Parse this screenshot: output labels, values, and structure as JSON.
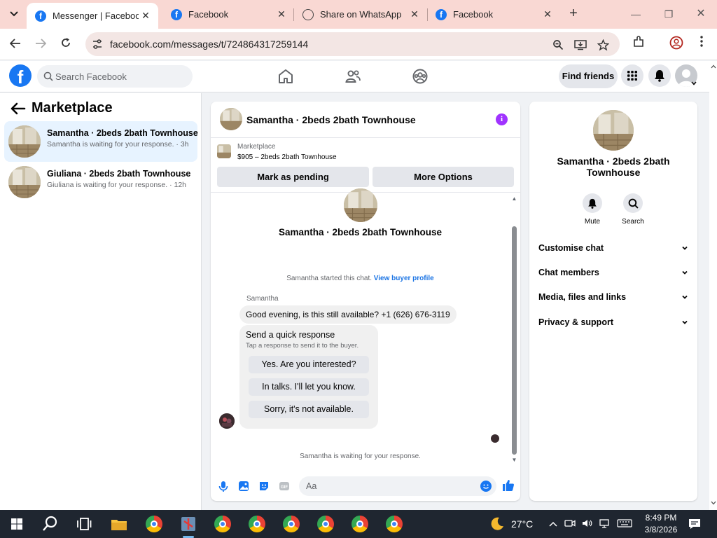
{
  "browser": {
    "tabs": [
      {
        "title": "Messenger | Facebook",
        "icon": "facebook-icon",
        "active": true
      },
      {
        "title": "Facebook",
        "icon": "facebook-icon",
        "active": false
      },
      {
        "title": "Share on WhatsApp",
        "icon": "globe-icon",
        "active": false
      },
      {
        "title": "Facebook",
        "icon": "facebook-icon",
        "active": false
      }
    ],
    "url": "facebook.com/messages/t/724864317259144"
  },
  "facebook": {
    "search_placeholder": "Search Facebook",
    "find_friends": "Find friends",
    "brand_color": "#1877f2"
  },
  "left_panel": {
    "title": "Marketplace",
    "conversations": [
      {
        "name": "Samantha · 2beds 2bath Townhouse",
        "preview": "Samantha is waiting for your response. · 3h",
        "selected": true
      },
      {
        "name": "Giuliana · 2beds 2bath Townhouse",
        "preview": "Giuliana is waiting for your response. · 12h",
        "selected": false
      }
    ]
  },
  "chat": {
    "header_title": "Samantha · 2beds 2bath Townhouse",
    "marketplace_label": "Marketplace",
    "listing": "$905 – 2beds 2bath Townhouse",
    "mark_pending": "Mark as pending",
    "more_options": "More Options",
    "intro_name": "Samantha · 2beds 2bath Townhouse",
    "started_text": "Samantha started this chat.",
    "view_profile": "View buyer profile",
    "sender": "Samantha",
    "message": "Good evening, is this still available? +1 (626) 676-3119",
    "quick_title": "Send a quick response",
    "quick_sub": "Tap a response to send it to the buyer.",
    "quick_responses": [
      "Yes. Are you interested?",
      "In talks. I'll let you know.",
      "Sorry, it's not available."
    ],
    "waiting": "Samantha is waiting for your response.",
    "composer_placeholder": "Aa",
    "accent_color": "#a033ff"
  },
  "right_panel": {
    "name": "Samantha · 2beds 2bath Townhouse",
    "mute": "Mute",
    "search": "Search",
    "sections": [
      "Customise chat",
      "Chat members",
      "Media, files and links",
      "Privacy & support"
    ]
  },
  "taskbar": {
    "temperature": "27°C",
    "time": "8:49 PM",
    "date": "3/8/2026"
  }
}
